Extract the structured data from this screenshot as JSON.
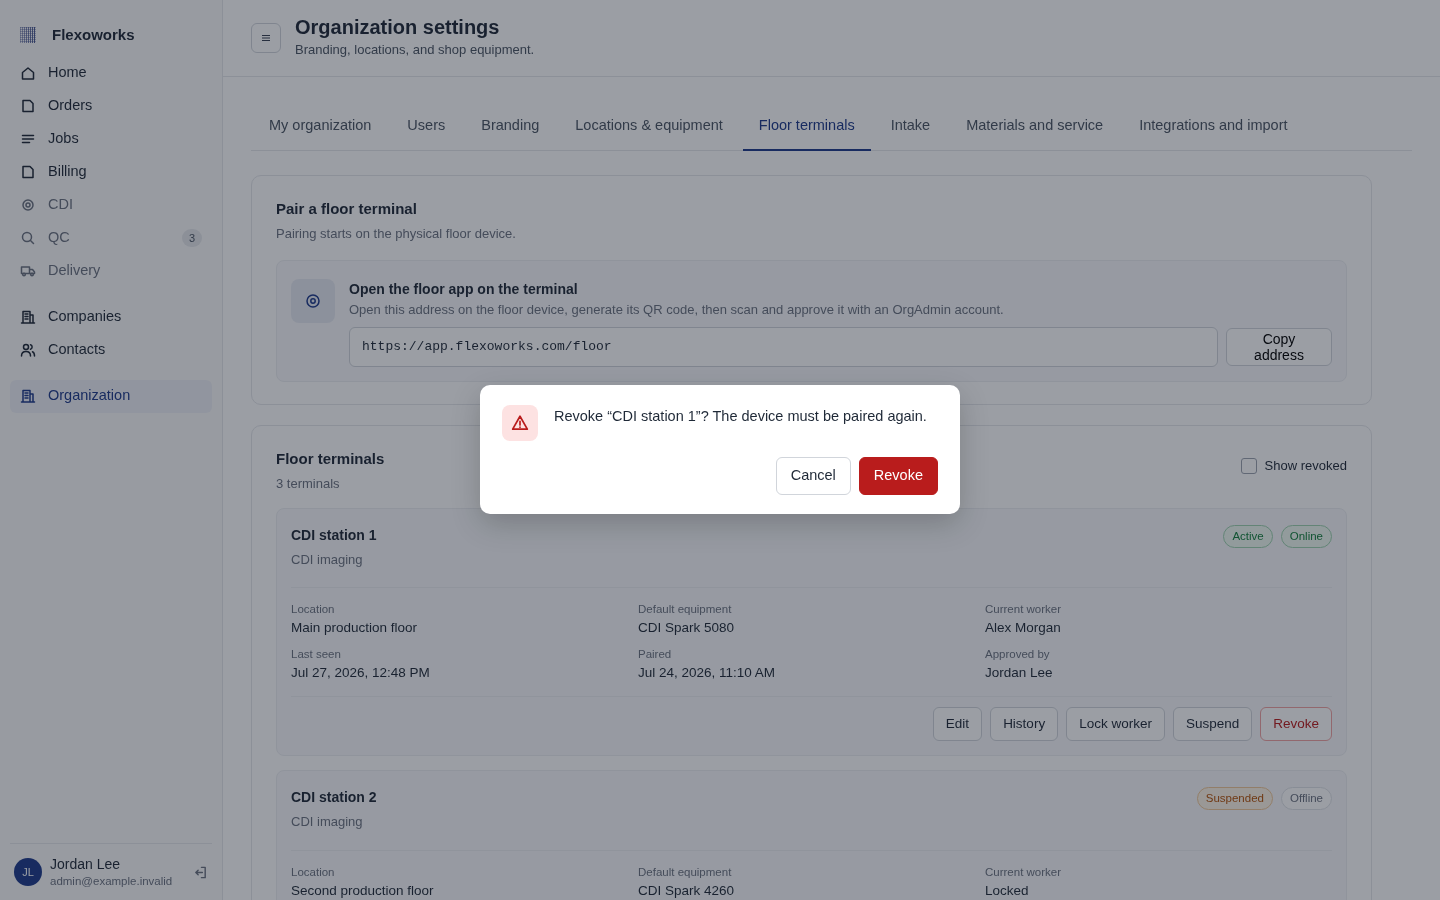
{
  "brand": {
    "name": "Flexoworks"
  },
  "sidebar": {
    "groups": [
      [
        {
          "label": "Home",
          "selected": false,
          "disabled": false
        },
        {
          "label": "Orders",
          "selected": false,
          "disabled": false
        },
        {
          "label": "Jobs",
          "selected": false,
          "disabled": false
        },
        {
          "label": "Billing",
          "selected": false,
          "disabled": false
        },
        {
          "label": "CDI",
          "selected": false,
          "disabled": true
        },
        {
          "label": "QC",
          "selected": false,
          "disabled": true,
          "badge": "3"
        },
        {
          "label": "Delivery",
          "selected": false,
          "disabled": true
        }
      ],
      [
        {
          "label": "Companies",
          "selected": false,
          "disabled": false
        },
        {
          "label": "Contacts",
          "selected": false,
          "disabled": false
        }
      ],
      [
        {
          "label": "Organization",
          "selected": true,
          "disabled": false
        }
      ]
    ]
  },
  "user": {
    "initials": "JL",
    "name": "Jordan Lee",
    "email": "admin@example.invalid"
  },
  "header": {
    "title": "Organization settings",
    "subtitle": "Branding, locations, and shop equipment."
  },
  "tabs": [
    {
      "label": "My organization",
      "selected": false
    },
    {
      "label": "Users",
      "selected": false
    },
    {
      "label": "Branding",
      "selected": false
    },
    {
      "label": "Locations & equipment",
      "selected": false
    },
    {
      "label": "Floor terminals",
      "selected": true
    },
    {
      "label": "Intake",
      "selected": false
    },
    {
      "label": "Materials and service",
      "selected": false
    },
    {
      "label": "Integrations and import",
      "selected": false
    }
  ],
  "pair_section": {
    "title": "Pair a floor terminal",
    "subtitle": "Pairing starts on the physical floor device.",
    "step": {
      "title": "Open the floor app on the terminal",
      "text": "Open this address on the floor device, generate its QR code, then scan and approve it with an OrgAdmin account.",
      "url": "https://app.flexoworks.com/floor",
      "copy_button": "Copy address"
    }
  },
  "terminals_section": {
    "title": "Floor terminals",
    "count": "3 terminals",
    "show_revoked": {
      "label": "Show revoked",
      "checked": false
    },
    "terminals": [
      {
        "name": "CDI station 1",
        "type": "CDI imaging",
        "statuses": [
          {
            "label": "Active",
            "kind": "success"
          },
          {
            "label": "Online",
            "kind": "success"
          }
        ],
        "fields": [
          {
            "label": "Location",
            "value": "Main production floor"
          },
          {
            "label": "Default equipment",
            "value": "CDI Spark 5080"
          },
          {
            "label": "Current worker",
            "value": "Alex Morgan"
          },
          {
            "label": "Last seen",
            "value": "Jul 27, 2026, 12:48 PM"
          },
          {
            "label": "Paired",
            "value": "Jul 24, 2026, 11:10 AM"
          },
          {
            "label": "Approved by",
            "value": "Jordan Lee"
          }
        ],
        "actions": [
          {
            "label": "Edit",
            "kind": "default"
          },
          {
            "label": "History",
            "kind": "default"
          },
          {
            "label": "Lock worker",
            "kind": "default"
          },
          {
            "label": "Suspend",
            "kind": "default"
          },
          {
            "label": "Revoke",
            "kind": "danger"
          }
        ]
      },
      {
        "name": "CDI station 2",
        "type": "CDI imaging",
        "statuses": [
          {
            "label": "Suspended",
            "kind": "warning"
          },
          {
            "label": "Offline",
            "kind": "neutral"
          }
        ],
        "fields": [
          {
            "label": "Location",
            "value": "Second production floor"
          },
          {
            "label": "Default equipment",
            "value": "CDI Spark 4260"
          },
          {
            "label": "Current worker",
            "value": "Locked"
          }
        ]
      }
    ]
  },
  "dialog": {
    "message": "Revoke “CDI station 1”? The device must be paired again.",
    "buttons": [
      {
        "label": "Cancel",
        "kind": "default"
      },
      {
        "label": "Revoke",
        "kind": "danger"
      }
    ]
  }
}
